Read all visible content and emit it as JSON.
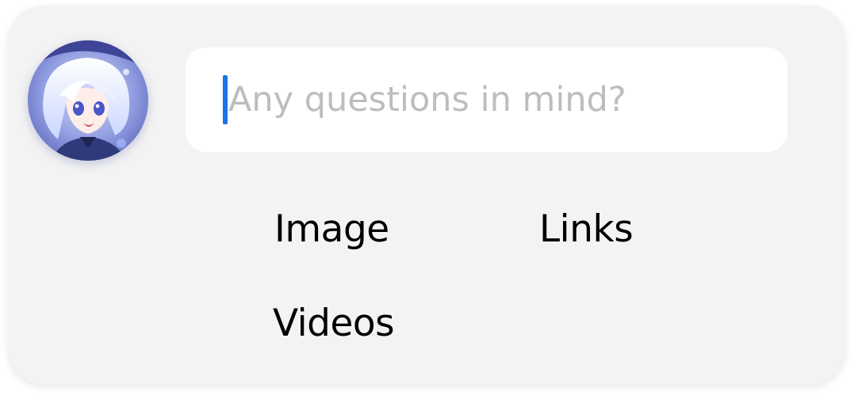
{
  "composer": {
    "placeholder": "Any questions in mind?",
    "value": ""
  },
  "avatar": {
    "icon": "user-avatar-anime-character"
  },
  "options": {
    "image_label": "Image",
    "links_label": "Links",
    "videos_label": "Videos"
  },
  "colors": {
    "card_background": "#f3f3f3",
    "input_background": "#ffffff",
    "caret": "#1a73e8",
    "placeholder": "#bdbdbd",
    "option_text": "#000000"
  }
}
